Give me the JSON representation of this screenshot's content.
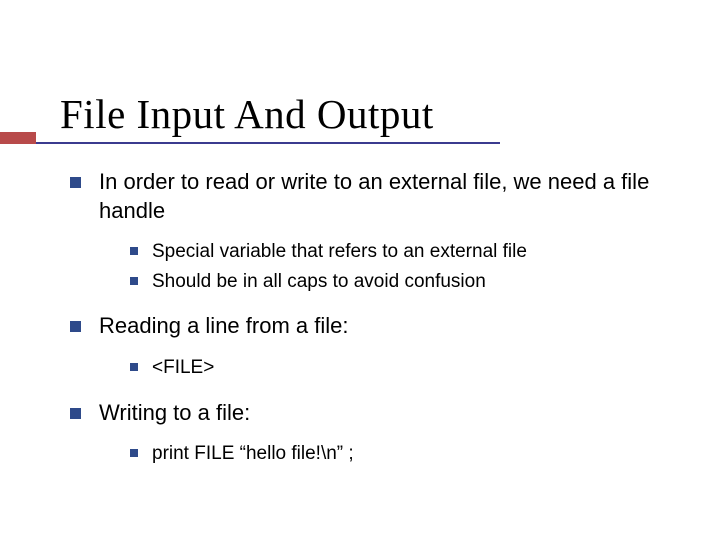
{
  "slide": {
    "title": "File Input And Output",
    "items": [
      {
        "text": "In order to read or write to an external file, we need a file handle",
        "children": [
          {
            "text": "Special variable that refers to an external file"
          },
          {
            "text": "Should be in all caps to avoid confusion"
          }
        ]
      },
      {
        "text": "Reading a line from a file:",
        "children": [
          {
            "text": "<FILE>"
          }
        ]
      },
      {
        "text": "Writing to a file:",
        "children": [
          {
            "text": "print FILE “hello file!\\n” ;"
          }
        ]
      }
    ]
  }
}
